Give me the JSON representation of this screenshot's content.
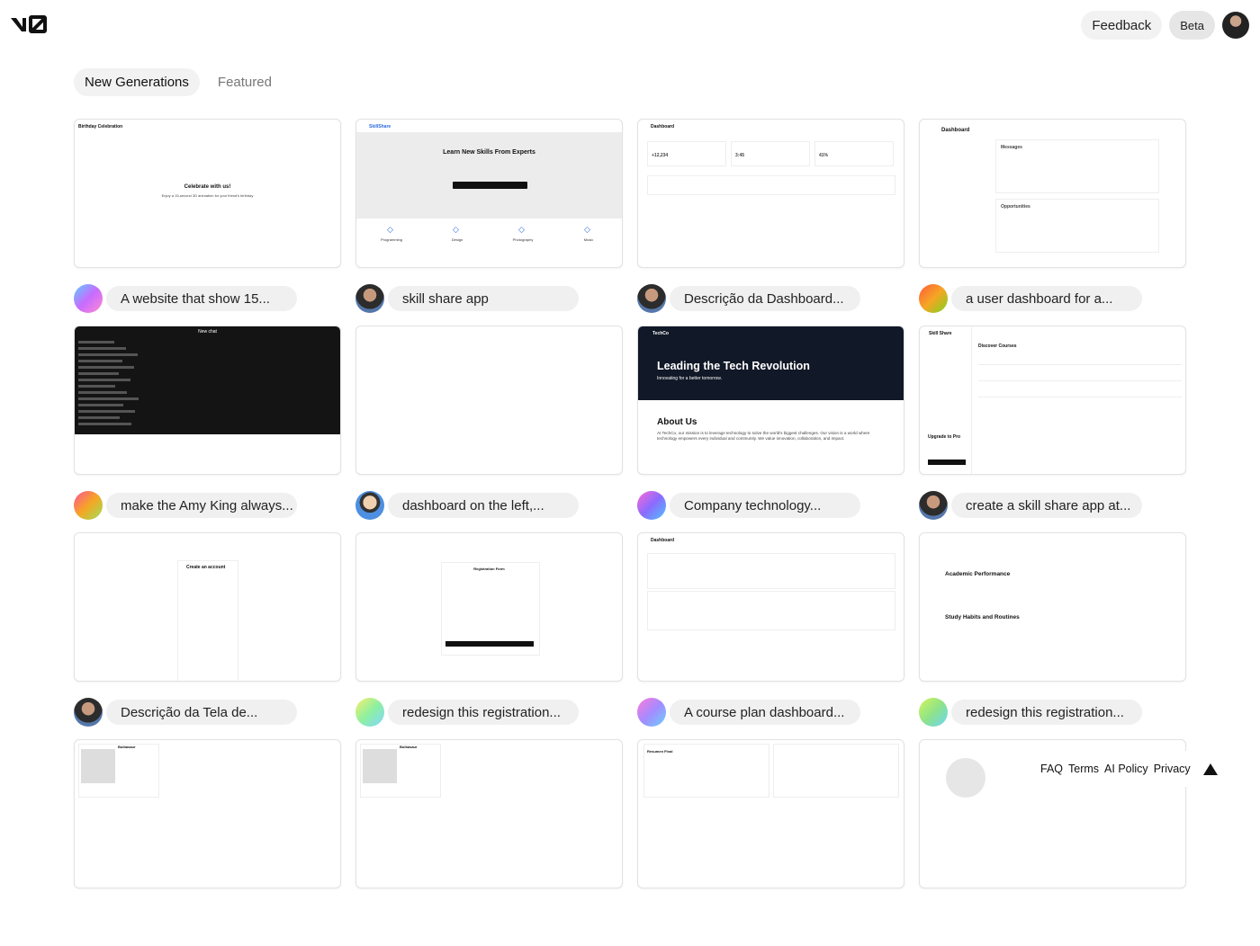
{
  "header": {
    "logo": "v0",
    "feedback": "Feedback",
    "beta": "Beta"
  },
  "tabs": [
    {
      "label": "New Generations",
      "active": true
    },
    {
      "label": "Featured",
      "active": false
    }
  ],
  "cards": [
    {
      "prompt": "A website that show 15...",
      "avatar": "gradient-blue-pink",
      "thumb": {
        "kind": "birthday",
        "title": "Birthday Celebration",
        "heading": "Celebrate with us!",
        "sub": "Enjoy a 15-second 3D animation for your friend's birthday"
      }
    },
    {
      "prompt": "skill share app",
      "avatar": "photo",
      "thumb": {
        "kind": "skillshare",
        "title": "SkillShare",
        "heading": "Learn New Skills From Experts",
        "items": [
          "Programming",
          "Design",
          "Photography",
          "Music"
        ]
      }
    },
    {
      "prompt": "Descrição da Dashboard...",
      "avatar": "photo",
      "thumb": {
        "kind": "dash",
        "title": "Dashboard",
        "stats": [
          "+12,234",
          "3:45",
          "41%"
        ]
      }
    },
    {
      "prompt": "a user dashboard for a...",
      "avatar": "gradient-orange-green",
      "thumb": {
        "kind": "userdash",
        "title": "Dashboard",
        "sections": [
          "Messages",
          "Opportunities"
        ]
      }
    },
    {
      "prompt": "make the Amy King always...",
      "avatar": "gradient-pink-yellow",
      "thumb": {
        "kind": "chat",
        "title": "New chat"
      }
    },
    {
      "prompt": "dashboard on the left,...",
      "avatar": "cartoon",
      "thumb": {
        "kind": "blank"
      }
    },
    {
      "prompt": "Company technology...",
      "avatar": "gradient-purple-blue",
      "thumb": {
        "kind": "techco",
        "title": "TechCo",
        "heading": "Leading the Tech Revolution",
        "sub": "Innovating for a better tomorrow.",
        "about": "About Us",
        "text": "At TechCo, our mission is to leverage technology to solve the world's biggest challenges. Our vision is a world where technology empowers every individual and community. We value innovation, collaboration, and impact."
      }
    },
    {
      "prompt": "create a skill share app at...",
      "avatar": "photo",
      "thumb": {
        "kind": "courses",
        "title": "Skill Share",
        "heading": "Discover Courses",
        "upgrade": "Upgrade to Pro"
      }
    },
    {
      "prompt": "Descrição da Tela de...",
      "avatar": "photo",
      "thumb": {
        "kind": "account",
        "heading": "Create an account"
      }
    },
    {
      "prompt": "redesign this registration...",
      "avatar": "gradient-yellow-pink",
      "thumb": {
        "kind": "regform",
        "heading": "Registration Form"
      }
    },
    {
      "prompt": "A course plan dashboard...",
      "avatar": "gradient-pink-blue",
      "thumb": {
        "kind": "table",
        "title": "Dashboard"
      }
    },
    {
      "prompt": "redesign this registration...",
      "avatar": "gradient-green-yellow",
      "thumb": {
        "kind": "academic",
        "heading": "Academic Performance",
        "heading2": "Study Habits and Routines"
      }
    },
    {
      "prompt": "",
      "avatar": "",
      "thumb": {
        "kind": "partial",
        "title": "Bulbasaur"
      }
    },
    {
      "prompt": "",
      "avatar": "",
      "thumb": {
        "kind": "partial",
        "title": "Bulbasaur"
      }
    },
    {
      "prompt": "",
      "avatar": "",
      "thumb": {
        "kind": "partial2",
        "title": "Resumen Final"
      }
    },
    {
      "prompt": "",
      "avatar": "",
      "thumb": {
        "kind": "circle"
      }
    }
  ],
  "footer": [
    "FAQ",
    "Terms",
    "AI Policy",
    "Privacy"
  ]
}
